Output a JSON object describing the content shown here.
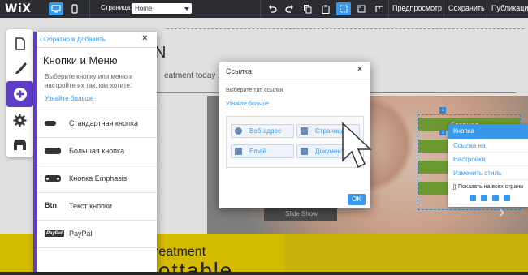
{
  "topbar": {
    "logo": "WiX",
    "page_label": "Страница:",
    "page_value": "Home",
    "preview": "Предпросмотр",
    "save": "Сохранить",
    "publish": "Публикация"
  },
  "canvas": {
    "heading": "N",
    "subheading": "eatment today 18",
    "band_text": "reatment",
    "band_big": "ottable",
    "slideshow_label": "Slide Show",
    "menu_item_label": "Главная"
  },
  "context_menu": {
    "title": "Кнопка",
    "items": [
      "Ссылка на",
      "Настройки",
      "Изменить стиль"
    ],
    "checkbox_label": "Показать на всех страни"
  },
  "add_panel": {
    "back_link": "Обратно в Добавить",
    "title": "Кнопки и Меню",
    "description": "Выберите кнопку или меню и настройте их так, как хотите.",
    "learn_more": "Узнайте больше",
    "items": [
      {
        "label": "Стандартная кнопка",
        "icon": "standard-button-icon"
      },
      {
        "label": "Большая кнопка",
        "icon": "large-button-icon"
      },
      {
        "label": "Кнопка Emphasis",
        "icon": "emphasis-button-icon"
      },
      {
        "label": "Текст кнопки",
        "icon_text": "Btn"
      },
      {
        "label": "PayPal",
        "icon_text": "PayPal"
      }
    ]
  },
  "link_dialog": {
    "title": "Ссылка",
    "subtitle": "Выберите тип ссылки",
    "learn_more": "Узнайте больше",
    "options": [
      "Веб-адрес",
      "Страница",
      "Email",
      "Документ"
    ],
    "ok": "OK"
  },
  "colors": {
    "accent": "#3899ec",
    "panel_accent": "#5f3ec7",
    "menu_green": "#7cae37",
    "band_yellow": "#f3d500"
  }
}
